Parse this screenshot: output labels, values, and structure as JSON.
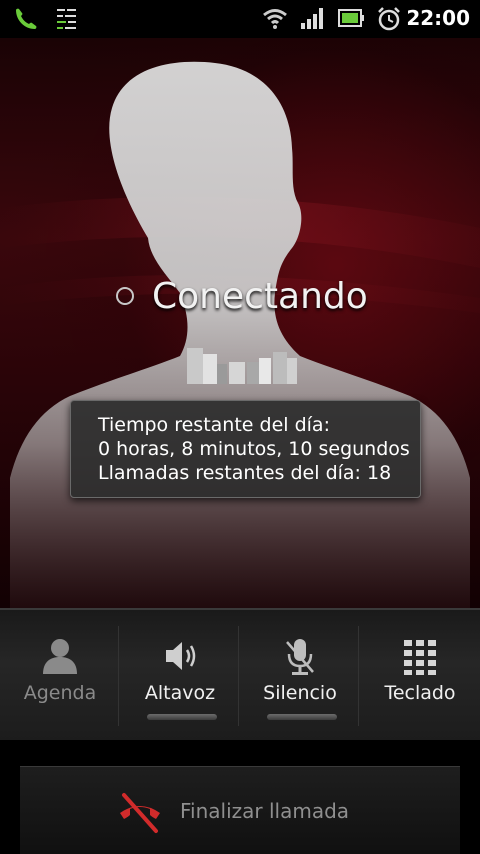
{
  "status_bar": {
    "time": "22:00",
    "icons": [
      "phone-call-icon",
      "sync-icon",
      "wifi-icon",
      "signal-icon",
      "battery-icon",
      "alarm-icon"
    ]
  },
  "call": {
    "status": "Conectando",
    "info": {
      "line1": "Tiempo restante del día:",
      "line2": "0 horas, 8 minutos, 10 segundos",
      "line3": "Llamadas restantes del día: 18"
    }
  },
  "controls": [
    {
      "label": "Agenda",
      "icon": "contact-icon",
      "enabled": false
    },
    {
      "label": "Altavoz",
      "icon": "speaker-icon",
      "enabled": true
    },
    {
      "label": "Silencio",
      "icon": "mute-mic-icon",
      "enabled": true
    },
    {
      "label": "Teclado",
      "icon": "keypad-icon",
      "enabled": true
    }
  ],
  "end_call": {
    "label": "Finalizar llamada",
    "icon": "end-call-icon"
  },
  "colors": {
    "accent_red": "#d12b2b",
    "background_red": "#3a070c",
    "status_green": "#6acb3a"
  }
}
